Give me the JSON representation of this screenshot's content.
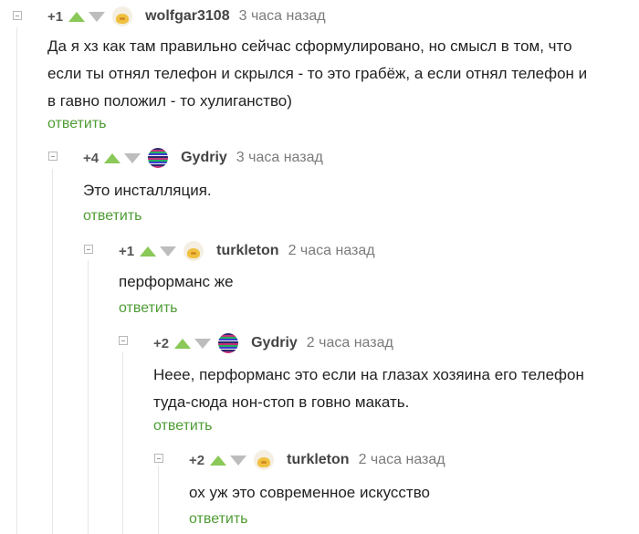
{
  "comments": [
    {
      "rating": "+1",
      "author": "wolfgar3108",
      "time": "3 часа назад",
      "text_lines": [
        "Да я хз как там правильно сейчас сформулировано, но смысл в том, что",
        "если ты отнял телефон и скрылся - то это грабёж, а если отнял телефон и",
        "в гавно положил - то хулиганство)"
      ],
      "reply": "ответить",
      "avatar": "cat-avatar"
    },
    {
      "rating": "+4",
      "author": "Gydriy",
      "time": "3 часа назад",
      "text_lines": [
        "Это инсталляция."
      ],
      "reply": "ответить",
      "avatar": "glitch-avatar"
    },
    {
      "rating": "+1",
      "author": "turkleton",
      "time": "2 часа назад",
      "text_lines": [
        "перформанс же"
      ],
      "reply": "ответить",
      "avatar": "cat-avatar"
    },
    {
      "rating": "+2",
      "author": "Gydriy",
      "time": "2 часа назад",
      "text_lines": [
        "Неее, перформанс это если на глазах хозяина его телефон",
        "туда-сюда нон-стоп в говно макать."
      ],
      "reply": "ответить",
      "avatar": "glitch-avatar"
    },
    {
      "rating": "+2",
      "author": "turkleton",
      "time": "2 часа назад",
      "text_lines": [
        "ох уж это современное искусство"
      ],
      "reply": "ответить",
      "avatar": "cat-avatar"
    }
  ],
  "colors": {
    "upvote": "#8ac858",
    "downvote": "#bdbdbd",
    "reply_link": "#4e9c34",
    "time": "#7b7b7b"
  }
}
